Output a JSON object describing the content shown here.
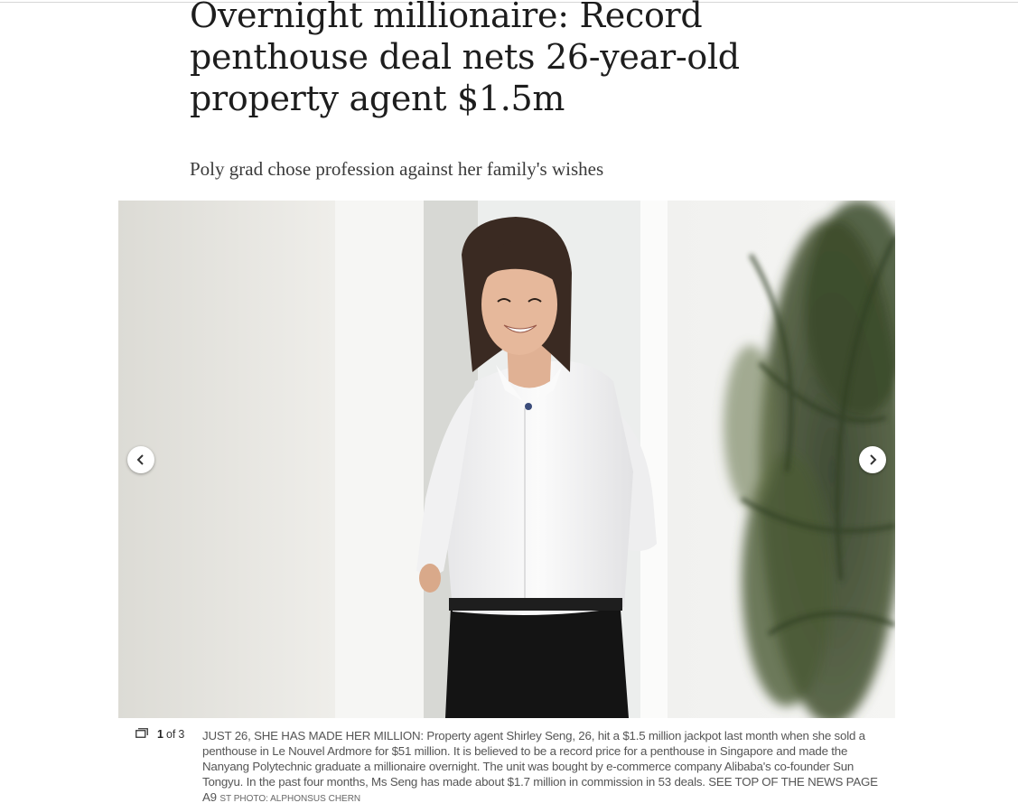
{
  "article": {
    "headline": "Overnight millionaire: Record penthouse deal nets 26-year-old property agent $1.5m",
    "standfirst": "Poly grad chose profession against her family's wishes"
  },
  "gallery": {
    "current": "1",
    "of_label": "of",
    "total": "3",
    "prev_icon": "chevron-left-icon",
    "next_icon": "chevron-right-icon",
    "gallery_icon": "gallery-icon",
    "caption": "JUST 26, SHE HAS MADE HER MILLION: Property agent Shirley Seng, 26, hit a $1.5 million jackpot last month when she sold a penthouse in Le Nouvel Ardmore for $51 million. It is believed to be a record price for a penthouse in Singapore and made the Nanyang Polytechnic graduate a millionaire overnight. The unit was bought by e-commerce company Alibaba's co-founder Sun Tongyu. In the past four months, Ms Seng has made about $1.7 million in commission in 53 deals. SEE TOP OF THE NEWS PAGE A9",
    "credit": "ST PHOTO: ALPHONSUS CHERN"
  },
  "colors": {
    "headline": "#1d1d1d",
    "caption": "#555555",
    "photo_background": "#e9e8e4"
  }
}
